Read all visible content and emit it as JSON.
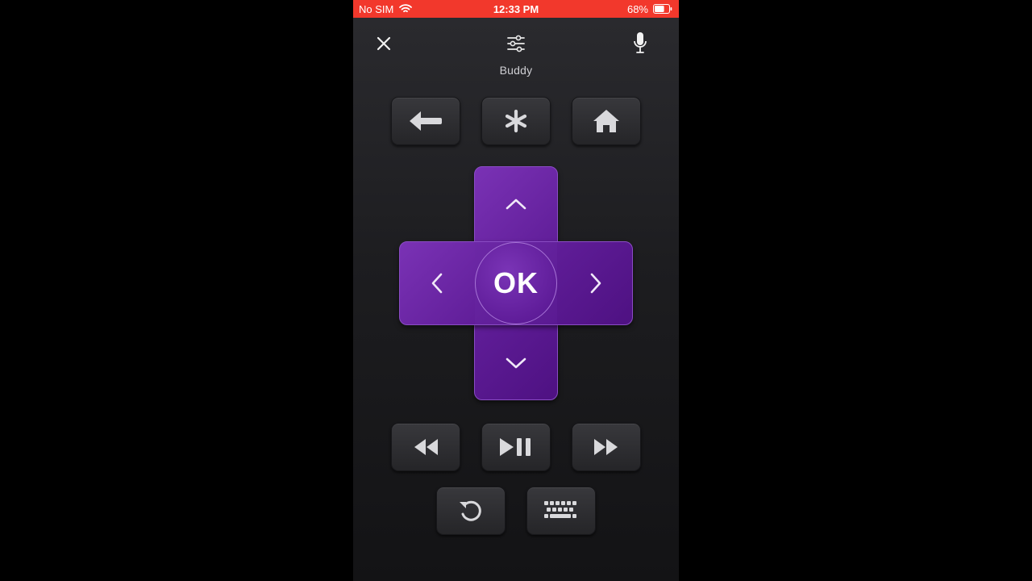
{
  "status_bar": {
    "carrier": "No SIM",
    "time": "12:33 PM",
    "battery_percent": "68%",
    "battery_level": 0.68,
    "background_color": "#f2382c"
  },
  "header": {
    "device_name": "Buddy",
    "icons": [
      "close-icon",
      "settings-sliders-icon",
      "microphone-icon"
    ]
  },
  "top_row": {
    "buttons": [
      "back-arrow-icon",
      "asterisk-icon",
      "home-icon"
    ]
  },
  "dpad": {
    "ok_label": "OK",
    "accent_color": "#6a22a8",
    "icons": [
      "chevron-up-icon",
      "chevron-down-icon",
      "chevron-left-icon",
      "chevron-right-icon"
    ]
  },
  "media_row": {
    "buttons": [
      "rewind-icon",
      "play-pause-icon",
      "fast-forward-icon"
    ]
  },
  "bottom_row": {
    "buttons": [
      "replay-icon",
      "keyboard-icon"
    ]
  }
}
